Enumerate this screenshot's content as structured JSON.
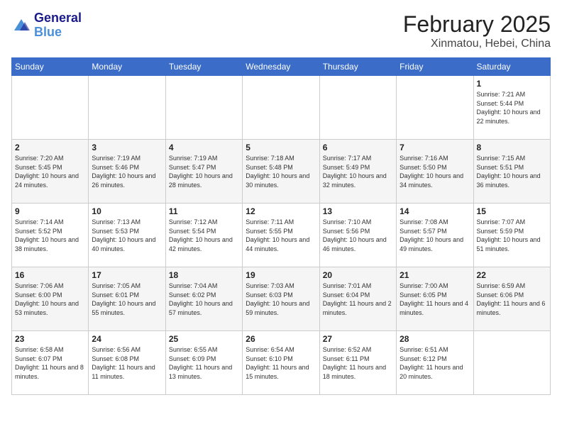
{
  "header": {
    "logo": {
      "line1": "General",
      "line2": "Blue"
    },
    "title": "February 2025",
    "subtitle": "Xinmatou, Hebei, China"
  },
  "days_of_week": [
    "Sunday",
    "Monday",
    "Tuesday",
    "Wednesday",
    "Thursday",
    "Friday",
    "Saturday"
  ],
  "weeks": [
    [
      {
        "day": "",
        "content": ""
      },
      {
        "day": "",
        "content": ""
      },
      {
        "day": "",
        "content": ""
      },
      {
        "day": "",
        "content": ""
      },
      {
        "day": "",
        "content": ""
      },
      {
        "day": "",
        "content": ""
      },
      {
        "day": "1",
        "content": "Sunrise: 7:21 AM\nSunset: 5:44 PM\nDaylight: 10 hours and 22 minutes."
      }
    ],
    [
      {
        "day": "2",
        "content": "Sunrise: 7:20 AM\nSunset: 5:45 PM\nDaylight: 10 hours and 24 minutes."
      },
      {
        "day": "3",
        "content": "Sunrise: 7:19 AM\nSunset: 5:46 PM\nDaylight: 10 hours and 26 minutes."
      },
      {
        "day": "4",
        "content": "Sunrise: 7:19 AM\nSunset: 5:47 PM\nDaylight: 10 hours and 28 minutes."
      },
      {
        "day": "5",
        "content": "Sunrise: 7:18 AM\nSunset: 5:48 PM\nDaylight: 10 hours and 30 minutes."
      },
      {
        "day": "6",
        "content": "Sunrise: 7:17 AM\nSunset: 5:49 PM\nDaylight: 10 hours and 32 minutes."
      },
      {
        "day": "7",
        "content": "Sunrise: 7:16 AM\nSunset: 5:50 PM\nDaylight: 10 hours and 34 minutes."
      },
      {
        "day": "8",
        "content": "Sunrise: 7:15 AM\nSunset: 5:51 PM\nDaylight: 10 hours and 36 minutes."
      }
    ],
    [
      {
        "day": "9",
        "content": "Sunrise: 7:14 AM\nSunset: 5:52 PM\nDaylight: 10 hours and 38 minutes."
      },
      {
        "day": "10",
        "content": "Sunrise: 7:13 AM\nSunset: 5:53 PM\nDaylight: 10 hours and 40 minutes."
      },
      {
        "day": "11",
        "content": "Sunrise: 7:12 AM\nSunset: 5:54 PM\nDaylight: 10 hours and 42 minutes."
      },
      {
        "day": "12",
        "content": "Sunrise: 7:11 AM\nSunset: 5:55 PM\nDaylight: 10 hours and 44 minutes."
      },
      {
        "day": "13",
        "content": "Sunrise: 7:10 AM\nSunset: 5:56 PM\nDaylight: 10 hours and 46 minutes."
      },
      {
        "day": "14",
        "content": "Sunrise: 7:08 AM\nSunset: 5:57 PM\nDaylight: 10 hours and 49 minutes."
      },
      {
        "day": "15",
        "content": "Sunrise: 7:07 AM\nSunset: 5:59 PM\nDaylight: 10 hours and 51 minutes."
      }
    ],
    [
      {
        "day": "16",
        "content": "Sunrise: 7:06 AM\nSunset: 6:00 PM\nDaylight: 10 hours and 53 minutes."
      },
      {
        "day": "17",
        "content": "Sunrise: 7:05 AM\nSunset: 6:01 PM\nDaylight: 10 hours and 55 minutes."
      },
      {
        "day": "18",
        "content": "Sunrise: 7:04 AM\nSunset: 6:02 PM\nDaylight: 10 hours and 57 minutes."
      },
      {
        "day": "19",
        "content": "Sunrise: 7:03 AM\nSunset: 6:03 PM\nDaylight: 10 hours and 59 minutes."
      },
      {
        "day": "20",
        "content": "Sunrise: 7:01 AM\nSunset: 6:04 PM\nDaylight: 11 hours and 2 minutes."
      },
      {
        "day": "21",
        "content": "Sunrise: 7:00 AM\nSunset: 6:05 PM\nDaylight: 11 hours and 4 minutes."
      },
      {
        "day": "22",
        "content": "Sunrise: 6:59 AM\nSunset: 6:06 PM\nDaylight: 11 hours and 6 minutes."
      }
    ],
    [
      {
        "day": "23",
        "content": "Sunrise: 6:58 AM\nSunset: 6:07 PM\nDaylight: 11 hours and 8 minutes."
      },
      {
        "day": "24",
        "content": "Sunrise: 6:56 AM\nSunset: 6:08 PM\nDaylight: 11 hours and 11 minutes."
      },
      {
        "day": "25",
        "content": "Sunrise: 6:55 AM\nSunset: 6:09 PM\nDaylight: 11 hours and 13 minutes."
      },
      {
        "day": "26",
        "content": "Sunrise: 6:54 AM\nSunset: 6:10 PM\nDaylight: 11 hours and 15 minutes."
      },
      {
        "day": "27",
        "content": "Sunrise: 6:52 AM\nSunset: 6:11 PM\nDaylight: 11 hours and 18 minutes."
      },
      {
        "day": "28",
        "content": "Sunrise: 6:51 AM\nSunset: 6:12 PM\nDaylight: 11 hours and 20 minutes."
      },
      {
        "day": "",
        "content": ""
      }
    ]
  ]
}
